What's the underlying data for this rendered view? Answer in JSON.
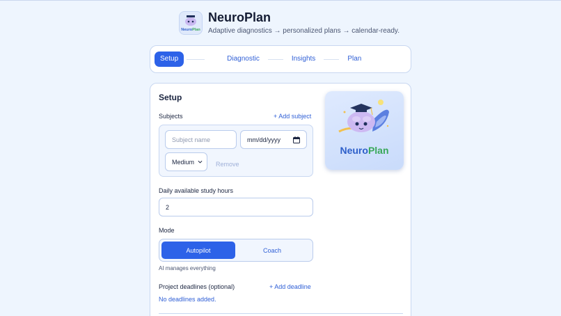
{
  "header": {
    "title": "NeuroPlan",
    "subtitle": "Adaptive diagnostics → personalized plans → calendar-ready.",
    "logo_text": "NeuroPlan"
  },
  "stepper": {
    "steps": [
      {
        "label": "Setup",
        "active": true
      },
      {
        "label": "Diagnostic",
        "active": false
      },
      {
        "label": "Insights",
        "active": false
      },
      {
        "label": "Plan",
        "active": false
      }
    ]
  },
  "setup": {
    "title": "Setup",
    "subjects_label": "Subjects",
    "add_subject": "+ Add subject",
    "subject_name_placeholder": "Subject name",
    "date_placeholder": "mm/dd/yyyy",
    "difficulty_value": "Medium",
    "remove_label": "Remove",
    "hours_label": "Daily available study hours",
    "hours_value": "2",
    "mode_label": "Mode",
    "mode_options": [
      "Autopilot",
      "Coach"
    ],
    "mode_selected": "Autopilot",
    "mode_hint": "AI manages everything",
    "deadlines_label": "Project deadlines (optional)",
    "add_deadline": "+ Add deadline",
    "no_deadlines": "No deadlines added."
  },
  "mascot": {
    "brand_part1": "Neuro",
    "brand_part2": "Plan"
  },
  "colors": {
    "accent": "#2d62e8",
    "link": "#2f5fd6",
    "background": "#eef5fe",
    "border": "#c8d7f1"
  },
  "icons": {
    "calendar": "calendar-icon",
    "dropdown": "chevron-down-icon"
  }
}
